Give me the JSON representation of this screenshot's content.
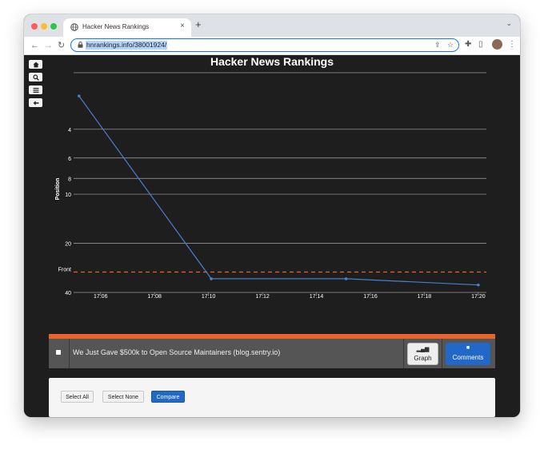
{
  "browser": {
    "tab_title": "Hacker News Rankings",
    "tab_close": "×",
    "new_tab": "+",
    "url": "hnrankings.info/38001924/",
    "back": "←",
    "forward": "→",
    "reload": "↻"
  },
  "sidebar": {
    "buttons": [
      {
        "icon": "home-icon"
      },
      {
        "icon": "search-icon"
      },
      {
        "icon": "list-icon"
      },
      {
        "icon": "arrow-left-icon"
      }
    ]
  },
  "chart_data": {
    "type": "line",
    "title": "Hacker News Rankings",
    "ylabel": "Position",
    "xlabel": "",
    "y_scale": "log",
    "y_inverted": true,
    "ylim": [
      1.8,
      40
    ],
    "y_ticks": [
      4,
      6,
      8,
      10,
      20,
      40
    ],
    "x_ticks": [
      "17:06",
      "17:08",
      "17:10",
      "17:12",
      "17:14",
      "17:16",
      "17:18",
      "17:20"
    ],
    "xlim": [
      "17:05",
      "17:20.3"
    ],
    "front_page_line": {
      "label": "Front",
      "value": 30,
      "color": "#e8642c",
      "style": "dashed"
    },
    "series": [
      {
        "color": "#4a7fc9",
        "points": [
          {
            "x": "17:05.2",
            "y": 2.5
          },
          {
            "x": "17:10.1",
            "y": 33
          },
          {
            "x": "17:15.1",
            "y": 33
          },
          {
            "x": "17:20.0",
            "y": 36
          }
        ]
      }
    ],
    "grid": true
  },
  "story": {
    "title": "We Just Gave $500k to Open Source Maintainers (blog.sentry.io)",
    "graph_label": "Graph",
    "comments_label": "Comments"
  },
  "actions": {
    "select_all": "Select All",
    "select_none": "Select None",
    "compare": "Compare"
  }
}
